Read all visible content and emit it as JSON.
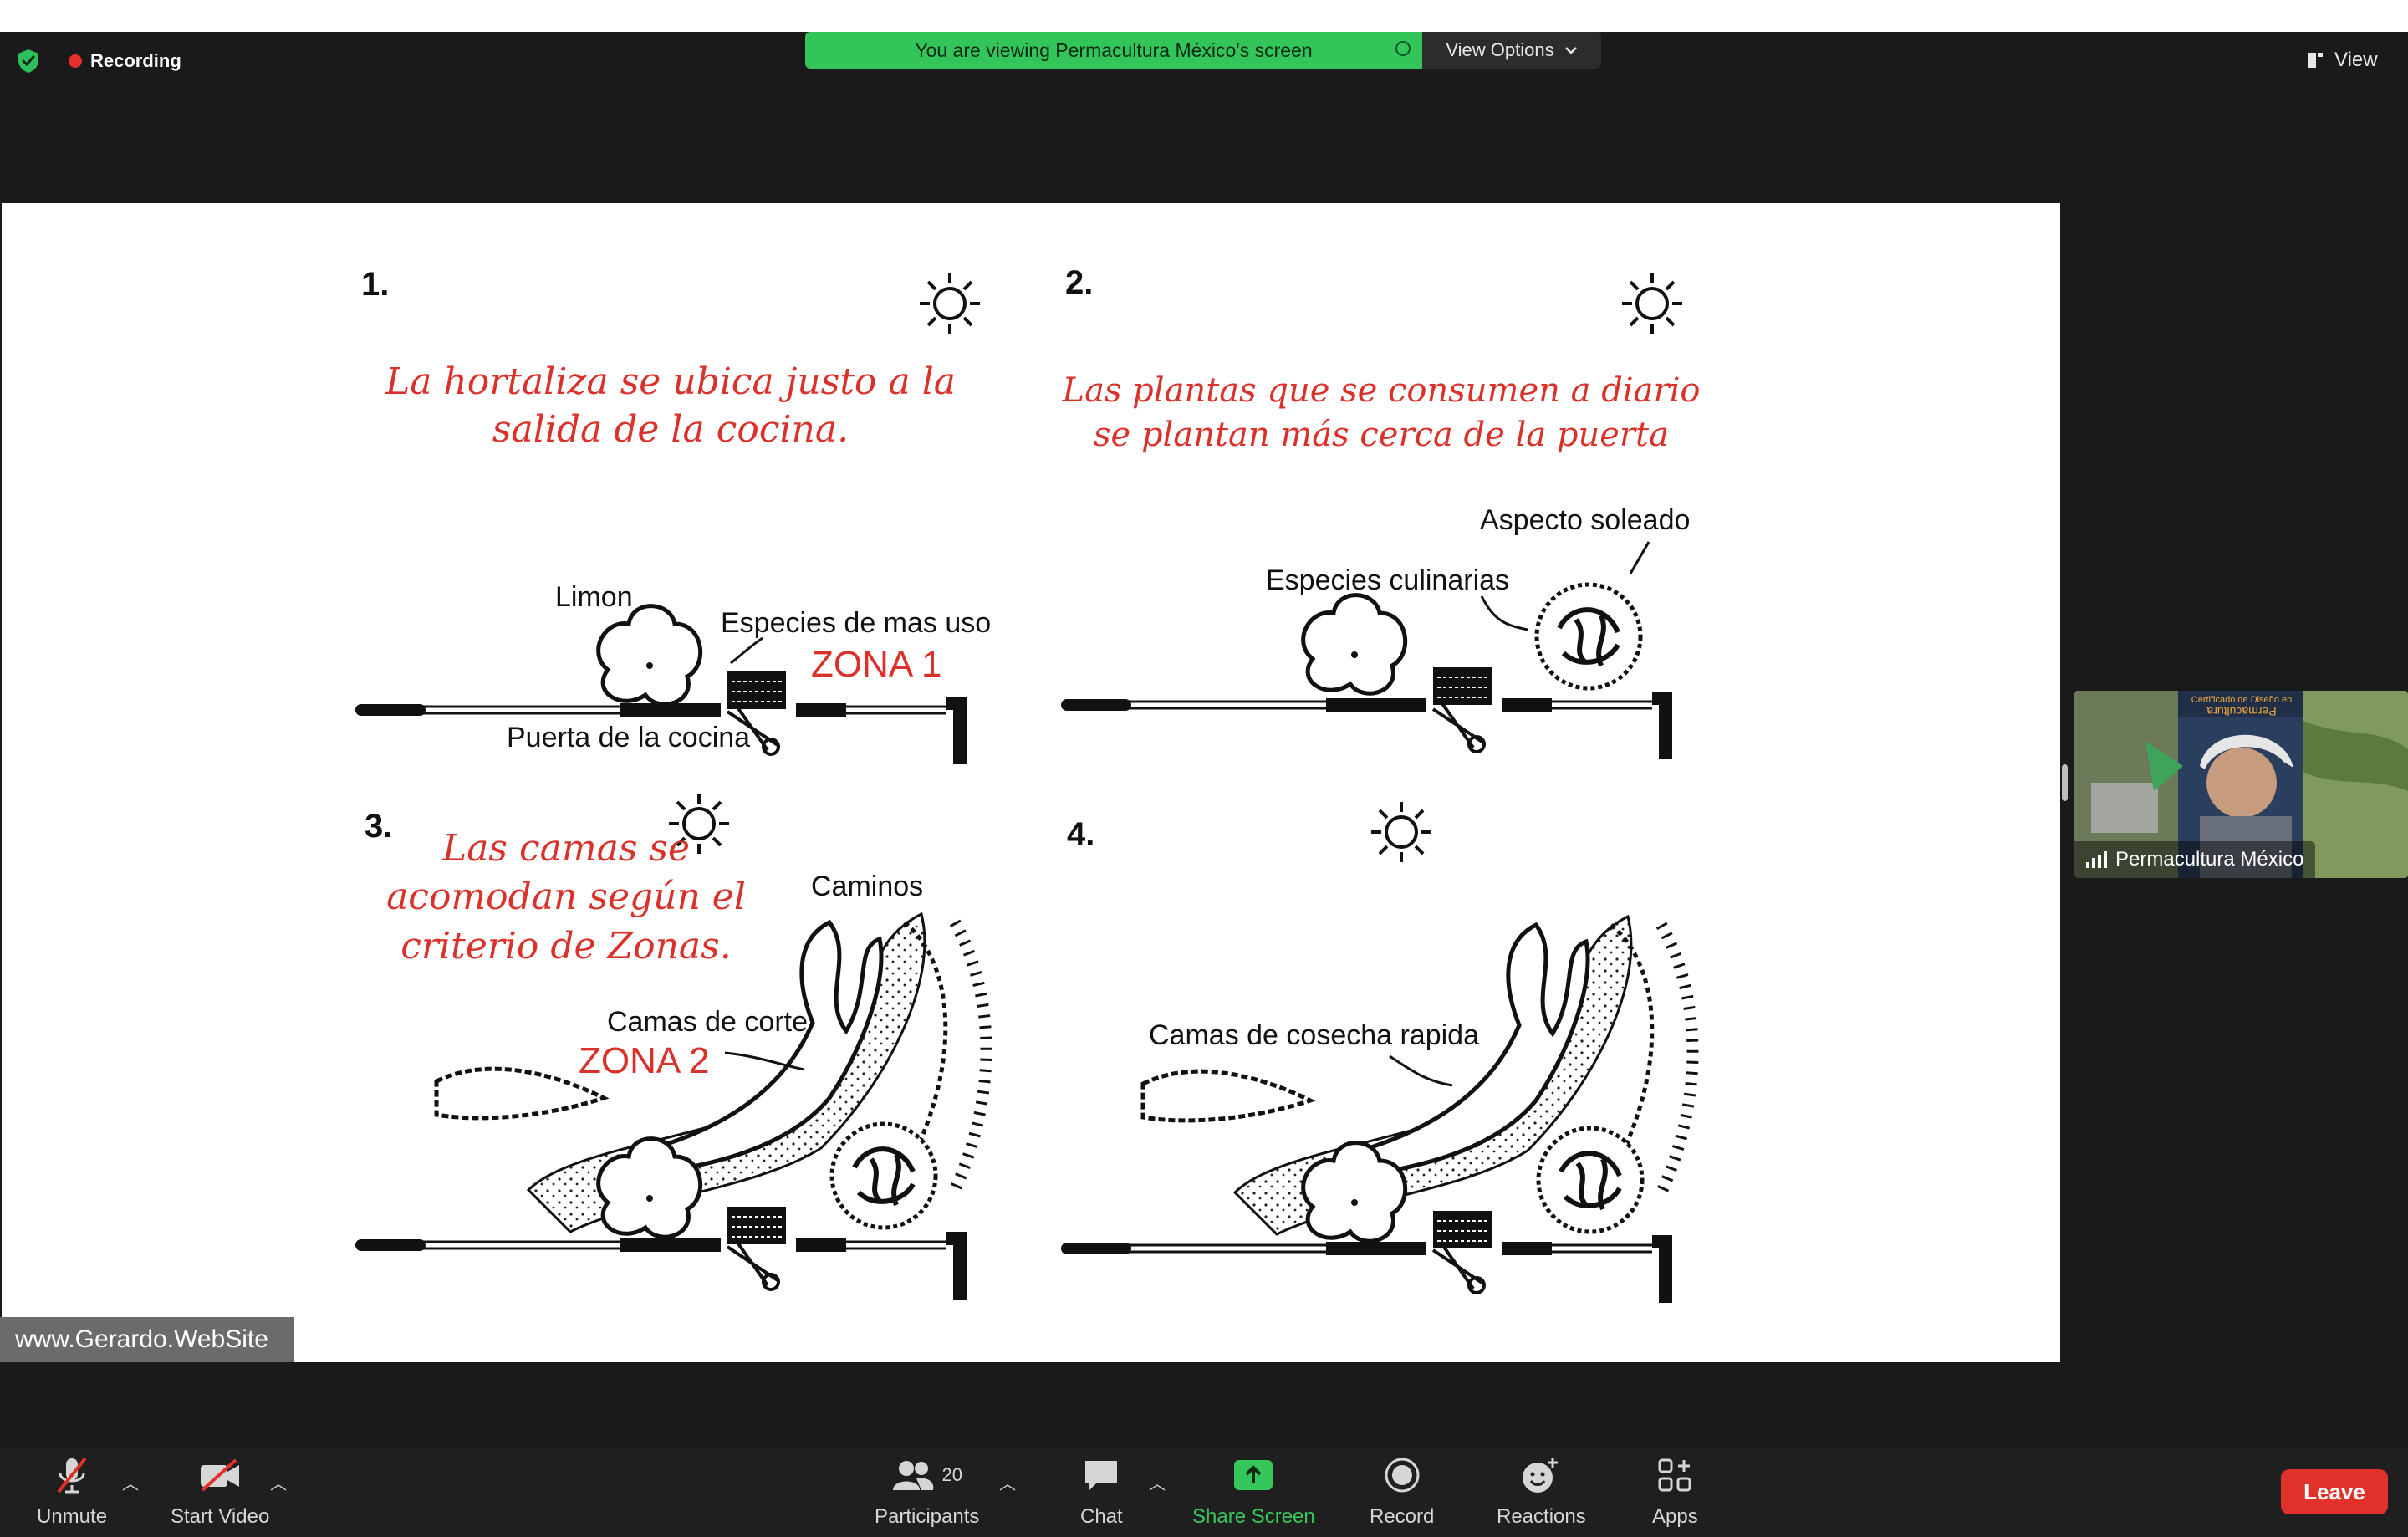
{
  "window": {
    "recording_label": "Recording"
  },
  "banner": {
    "text": "You are viewing Permacultura México's screen",
    "view_options": "View Options"
  },
  "view_button": "View",
  "slide": {
    "panels": [
      {
        "number": "1.",
        "caption": [
          "La hortaliza se ubica justo a la",
          "salida de la cocina."
        ],
        "labels": {
          "tree": "Limon",
          "species": "Especies de mas uso",
          "zone": "ZONA 1",
          "door": "Puerta de la cocina"
        }
      },
      {
        "number": "2.",
        "caption": [
          "Las plantas que se consumen a diario",
          "se plantan más cerca de la puerta"
        ],
        "labels": {
          "sunny": "Aspecto soleado",
          "culinary": "Especies culinarias"
        }
      },
      {
        "number": "3.",
        "caption": [
          "Las camas se",
          "acomodan según el",
          "criterio de Zonas."
        ],
        "labels": {
          "paths": "Caminos",
          "beds": "Camas de corte",
          "zone": "ZONA 2"
        }
      },
      {
        "number": "4.",
        "labels": {
          "quick": "Camas de cosecha rapida"
        }
      }
    ],
    "watermark": "www.Gerardo.WebSite"
  },
  "speaker": {
    "name": "Permacultura México",
    "thumb_title_1": "Certificado de Diseño en",
    "thumb_title_2": "Permacultura"
  },
  "toolbar": {
    "unmute": "Unmute",
    "start_video": "Start Video",
    "participants": "Participants",
    "participants_count": "20",
    "chat": "Chat",
    "share_screen": "Share Screen",
    "record": "Record",
    "reactions": "Reactions",
    "apps": "Apps",
    "leave": "Leave"
  },
  "colors": {
    "share_green": "#35c75a",
    "leave_red": "#e0322b",
    "banner_green": "#33c55a",
    "caption_red": "#d9322b"
  }
}
